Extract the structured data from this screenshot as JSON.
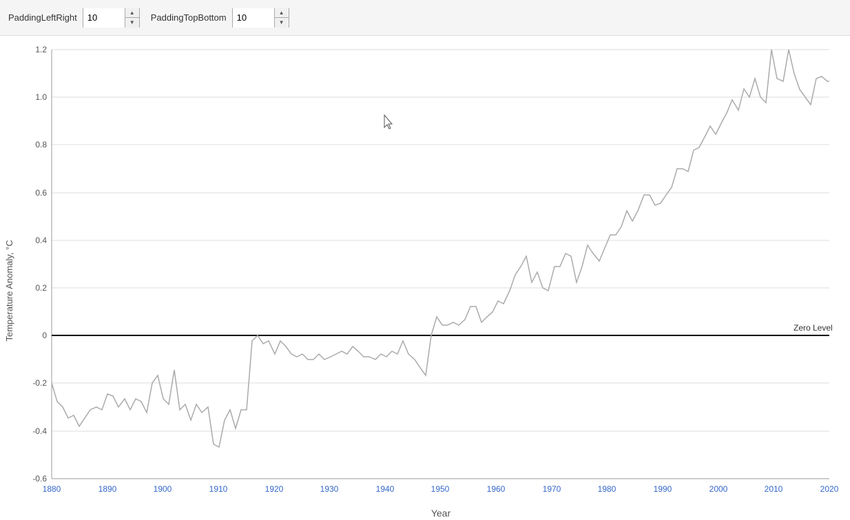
{
  "controls": {
    "paddingLeftRight": {
      "label": "PaddingLeftRight",
      "value": "10"
    },
    "paddingTopBottom": {
      "label": "PaddingTopBottom",
      "value": "10"
    },
    "spinnerUp": "▲",
    "spinnerDown": "▼"
  },
  "chart": {
    "xAxisLabel": "Year",
    "yAxisLabel": "Temperature Anomaly, °C",
    "zeroLineLabel": "Zero Level",
    "yMin": -0.6,
    "yMax": 1.2,
    "xMin": 1880,
    "xMax": 2020,
    "yTicks": [
      "-0.6",
      "-0.4",
      "-0.2",
      "0",
      "0.2",
      "0.4",
      "0.6",
      "0.8",
      "1.0",
      "1.2"
    ],
    "xTicks": [
      "1880",
      "1890",
      "1900",
      "1910",
      "1920",
      "1930",
      "1940",
      "1950",
      "1960",
      "1970",
      "1980",
      "1990",
      "2000",
      "2010",
      "2020"
    ]
  }
}
